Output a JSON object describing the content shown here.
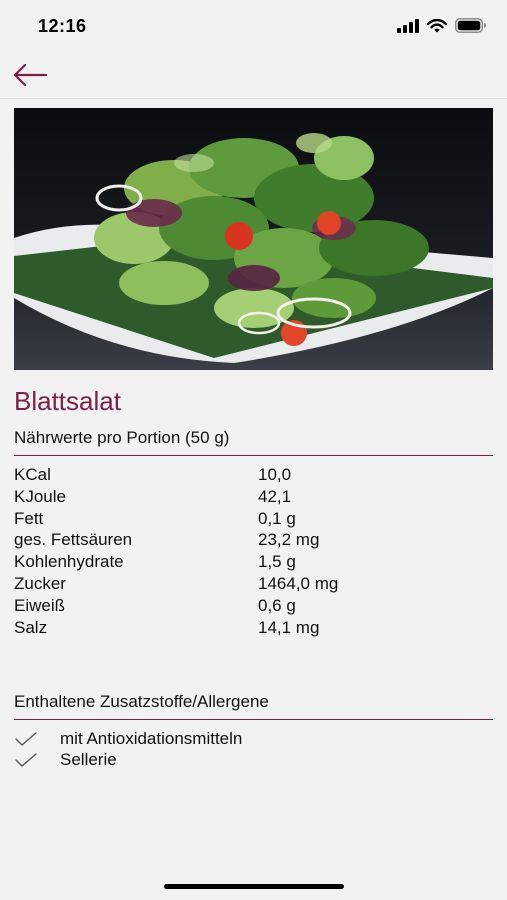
{
  "status_bar": {
    "time": "12:16",
    "icons": [
      "signal-icon",
      "wifi-icon",
      "battery-icon"
    ]
  },
  "nav": {
    "back_icon": "arrow-left-icon",
    "accent_color": "#7b1f4c"
  },
  "dish": {
    "title": "Blattsalat",
    "image_alt": "Blattsalat"
  },
  "nutrition": {
    "header": "Nährwerte pro Portion (50 g)",
    "rows": [
      {
        "name": "KCal",
        "value": "10,0"
      },
      {
        "name": "KJoule",
        "value": "42,1"
      },
      {
        "name": "Fett",
        "value": "0,1 g"
      },
      {
        "name": "ges. Fettsäuren",
        "value": "23,2 mg"
      },
      {
        "name": "Kohlenhydrate",
        "value": "1,5 g"
      },
      {
        "name": "Zucker",
        "value": "1464,0 mg"
      },
      {
        "name": "Eiweiß",
        "value": "0,6 g"
      },
      {
        "name": "Salz",
        "value": "14,1 mg"
      }
    ]
  },
  "allergens": {
    "header": "Enthaltene Zusatzstoffe/Allergene",
    "items": [
      {
        "label": "mit Antioxidationsmitteln",
        "icon": "check-icon"
      },
      {
        "label": "Sellerie",
        "icon": "check-icon"
      }
    ]
  }
}
